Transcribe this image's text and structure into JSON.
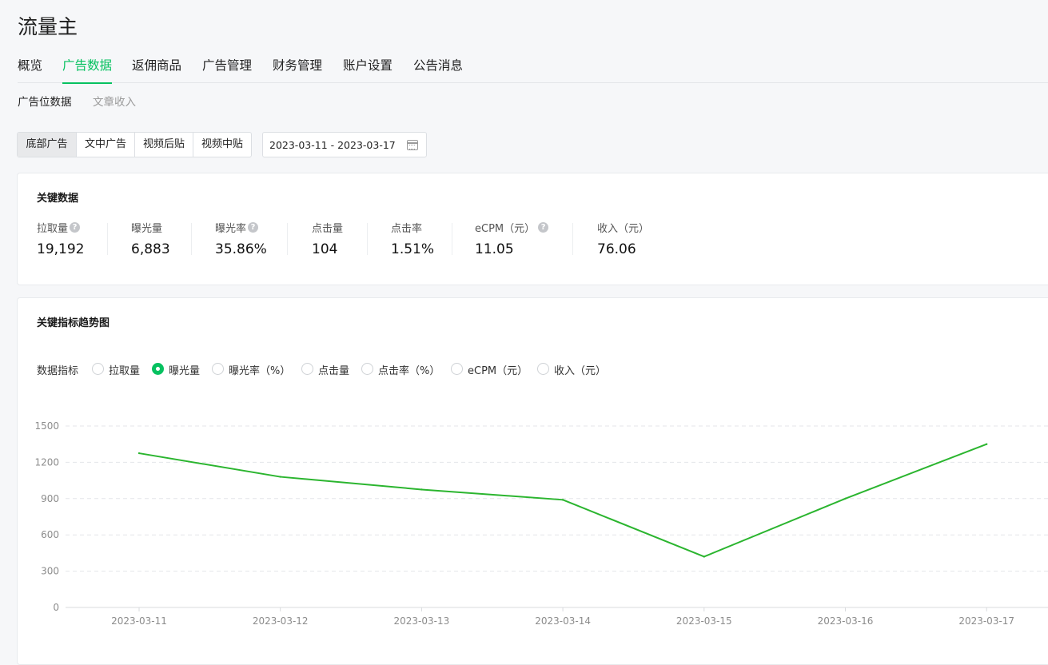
{
  "app_title": "流量主",
  "main_tabs": [
    {
      "label": "概览",
      "active": false
    },
    {
      "label": "广告数据",
      "active": true
    },
    {
      "label": "返佣商品",
      "active": false
    },
    {
      "label": "广告管理",
      "active": false
    },
    {
      "label": "财务管理",
      "active": false
    },
    {
      "label": "账户设置",
      "active": false
    },
    {
      "label": "公告消息",
      "active": false
    }
  ],
  "sub_tabs": [
    {
      "label": "广告位数据",
      "active": true
    },
    {
      "label": "文章收入",
      "active": false
    }
  ],
  "ad_types": [
    {
      "label": "底部广告",
      "active": true
    },
    {
      "label": "文中广告",
      "active": false
    },
    {
      "label": "视频后贴",
      "active": false
    },
    {
      "label": "视频中贴",
      "active": false
    }
  ],
  "date_range": "2023-03-11 - 2023-03-17",
  "key_data": {
    "title": "关键数据",
    "items": [
      {
        "label": "拉取量",
        "value": "19,192",
        "help": true
      },
      {
        "label": "曝光量",
        "value": "6,883",
        "help": false
      },
      {
        "label": "曝光率",
        "value": "35.86%",
        "help": true
      },
      {
        "label": "点击量",
        "value": "104",
        "help": false
      },
      {
        "label": "点击率",
        "value": "1.51%",
        "help": false
      },
      {
        "label": "eCPM（元）",
        "value": "11.05",
        "help": true
      },
      {
        "label": "收入（元）",
        "value": "76.06",
        "help": false
      }
    ]
  },
  "trend": {
    "title": "关键指标趋势图",
    "metric_label": "数据指标",
    "metrics": [
      {
        "label": "拉取量",
        "checked": false
      },
      {
        "label": "曝光量",
        "checked": true
      },
      {
        "label": "曝光率（%）",
        "checked": false
      },
      {
        "label": "点击量",
        "checked": false
      },
      {
        "label": "点击率（%）",
        "checked": false
      },
      {
        "label": "eCPM（元）",
        "checked": false
      },
      {
        "label": "收入（元）",
        "checked": false
      }
    ]
  },
  "chart_data": {
    "type": "line",
    "categories": [
      "2023-03-11",
      "2023-03-12",
      "2023-03-13",
      "2023-03-14",
      "2023-03-15",
      "2023-03-16",
      "2023-03-17"
    ],
    "series": [
      {
        "values": [
          1275,
          1080,
          975,
          890,
          420,
          900,
          1350
        ],
        "color": "#2bb52f"
      }
    ],
    "yticks": [
      0,
      300,
      600,
      900,
      1200,
      1500
    ],
    "ylim": [
      0,
      1500
    ],
    "grid": true
  },
  "colors": {
    "accent": "#07c160",
    "line": "#2bb52f"
  }
}
